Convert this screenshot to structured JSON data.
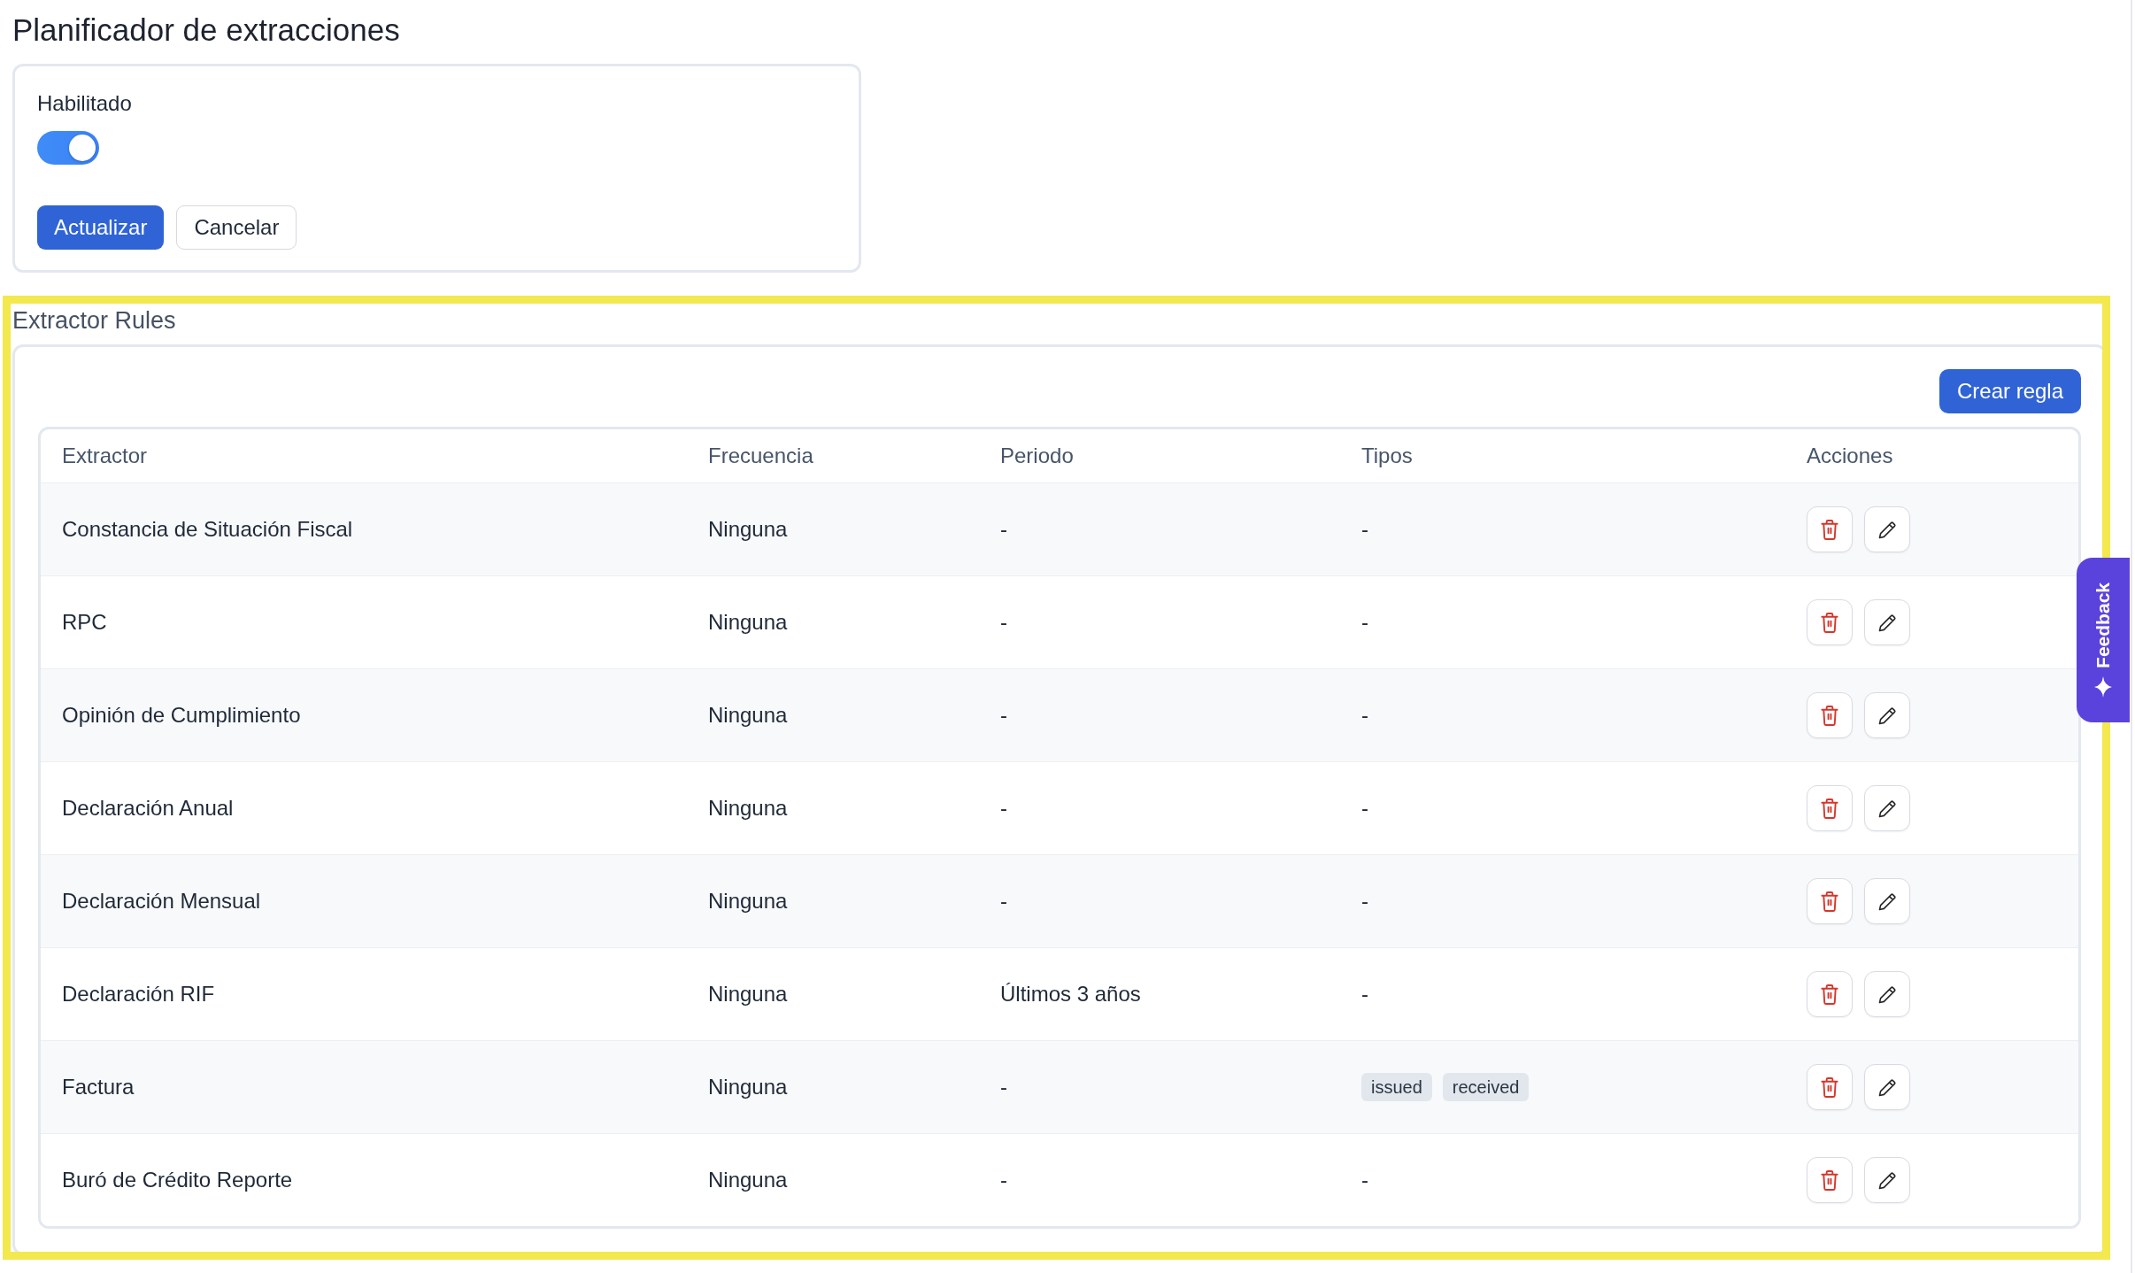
{
  "page_title": "Planificador de extracciones",
  "scheduler": {
    "enabled_label": "Habilitado",
    "enabled": true,
    "buttons": [
      {
        "label": "Actualizar",
        "kind": "primary"
      },
      {
        "label": "Cancelar",
        "kind": "secondary"
      }
    ]
  },
  "extractor_rules": {
    "title": "Extractor Rules",
    "create_button": "Crear regla",
    "table": {
      "columns": [
        "Extractor",
        "Frecuencia",
        "Periodo",
        "Tipos",
        "Acciones"
      ],
      "rows": [
        {
          "extractor": "Constancia de Situación Fiscal",
          "frecuencia": "Ninguna",
          "periodo": "-",
          "tipos": "-"
        },
        {
          "extractor": "RPC",
          "frecuencia": "Ninguna",
          "periodo": "-",
          "tipos": "-"
        },
        {
          "extractor": "Opinión de Cumplimiento",
          "frecuencia": "Ninguna",
          "periodo": "-",
          "tipos": "-"
        },
        {
          "extractor": "Declaración Anual",
          "frecuencia": "Ninguna",
          "periodo": "-",
          "tipos": "-"
        },
        {
          "extractor": "Declaración Mensual",
          "frecuencia": "Ninguna",
          "periodo": "-",
          "tipos": "-"
        },
        {
          "extractor": "Declaración RIF",
          "frecuencia": "Ninguna",
          "periodo": "Últimos 3 años",
          "tipos": "-"
        },
        {
          "extractor": "Factura",
          "frecuencia": "Ninguna",
          "periodo": "-",
          "tipos": [
            "issued",
            "received"
          ]
        },
        {
          "extractor": "Buró de Crédito Reporte",
          "frecuencia": "Ninguna",
          "periodo": "-",
          "tipos": "-"
        }
      ]
    }
  },
  "feedback_tab": {
    "label": "Feedback"
  }
}
